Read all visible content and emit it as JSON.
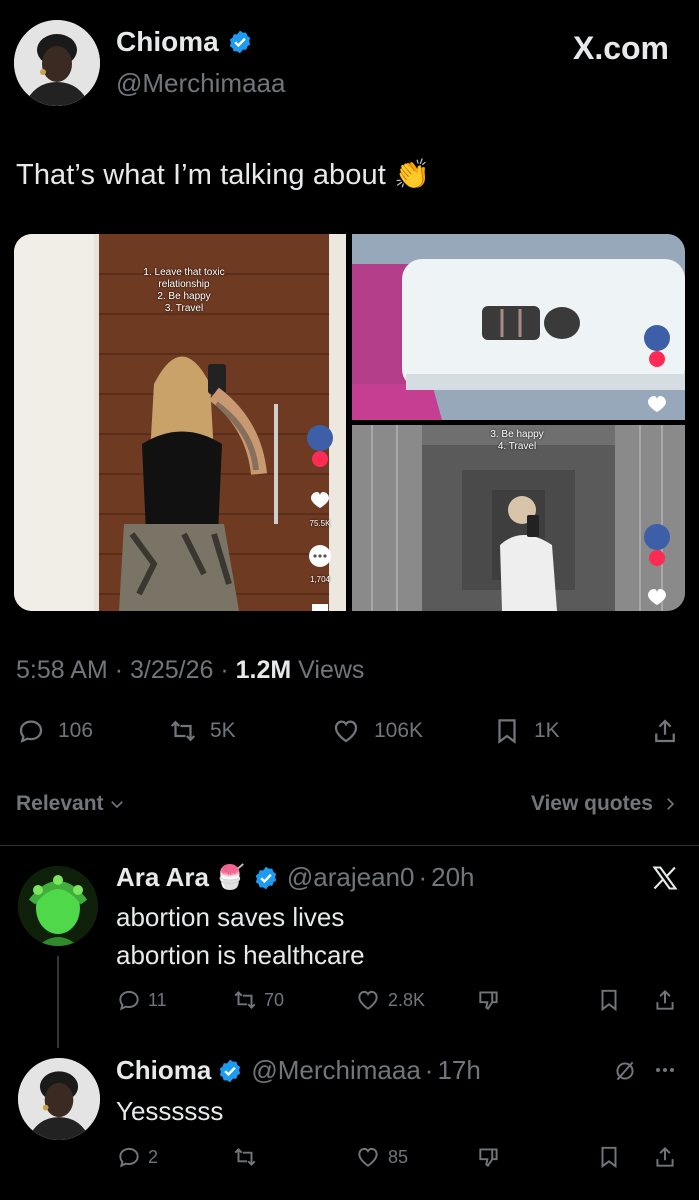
{
  "author": {
    "name": "Chioma",
    "handle": "@Merchimaaa",
    "site": "X.com"
  },
  "tweet": {
    "text": "That’s what I’m talking about 👏",
    "time": "5:58 AM",
    "date": "3/25/26",
    "views_count": "1.2M",
    "views_label": "Views",
    "sep": "·"
  },
  "media": {
    "left_overlay": [
      "1. Leave that toxic",
      "relationship",
      "2. Be happy",
      "3. Travel"
    ],
    "left_likes": "75.5K",
    "left_comments": "1,704",
    "bottom_right_overlay": [
      "3. Be happy",
      "4. Travel"
    ]
  },
  "actions": {
    "replies": "106",
    "reposts": "5K",
    "likes": "106K",
    "bookmarks": "1K"
  },
  "sort": {
    "label": "Relevant",
    "view_quotes": "View quotes"
  },
  "replies": [
    {
      "name": "Ara Ara",
      "emoji": "🍧",
      "handle": "@arajean0",
      "age": "20h",
      "lines": [
        "abortion saves lives",
        "abortion is healthcare"
      ],
      "replies": "11",
      "reposts": "70",
      "likes": "2.8K"
    },
    {
      "name": "Chioma",
      "handle": "@Merchimaaa",
      "age": "17h",
      "lines": [
        "Yessssss"
      ],
      "replies": "2",
      "likes": "85"
    }
  ],
  "colors": {
    "background": "#000000",
    "text": "#e7e9ea",
    "muted": "#71767b",
    "verified": "#1d9bf0",
    "divider": "#2f3336"
  }
}
